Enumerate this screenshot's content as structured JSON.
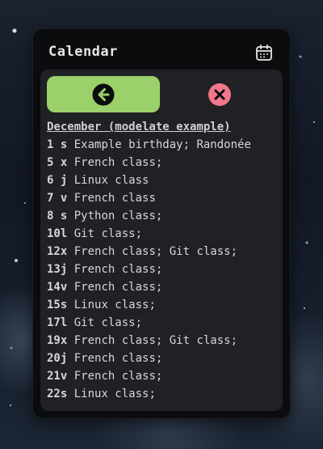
{
  "widget": {
    "title": "Calendar",
    "calendar_icon": "calendar-icon",
    "back_icon": "arrow-left-circle-icon",
    "close_icon": "close-circle-icon",
    "colors": {
      "back_button": "#9cd06a",
      "close_button": "#f1778a",
      "panel": "#1f2125",
      "widget_bg": "#0b0c0e"
    }
  },
  "month_heading": "December (modelate example)",
  "events": [
    {
      "day": "1 s",
      "text": "Example birthday; Randonée"
    },
    {
      "day": "5 x",
      "text": "French class;"
    },
    {
      "day": "6 j",
      "text": "Linux class"
    },
    {
      "day": "7 v",
      "text": "French class"
    },
    {
      "day": "8 s",
      "text": "Python class;"
    },
    {
      "day": "10l",
      "text": "Git class;"
    },
    {
      "day": "12x",
      "text": "French class; Git class;"
    },
    {
      "day": "13j",
      "text": "French class;"
    },
    {
      "day": "14v",
      "text": "French class;"
    },
    {
      "day": "15s",
      "text": "Linux class;"
    },
    {
      "day": "17l",
      "text": "Git class;"
    },
    {
      "day": "19x",
      "text": "French class; Git class;"
    },
    {
      "day": "20j",
      "text": "French class;"
    },
    {
      "day": "21v",
      "text": "French class;"
    },
    {
      "day": "22s",
      "text": "Linux class;"
    }
  ]
}
